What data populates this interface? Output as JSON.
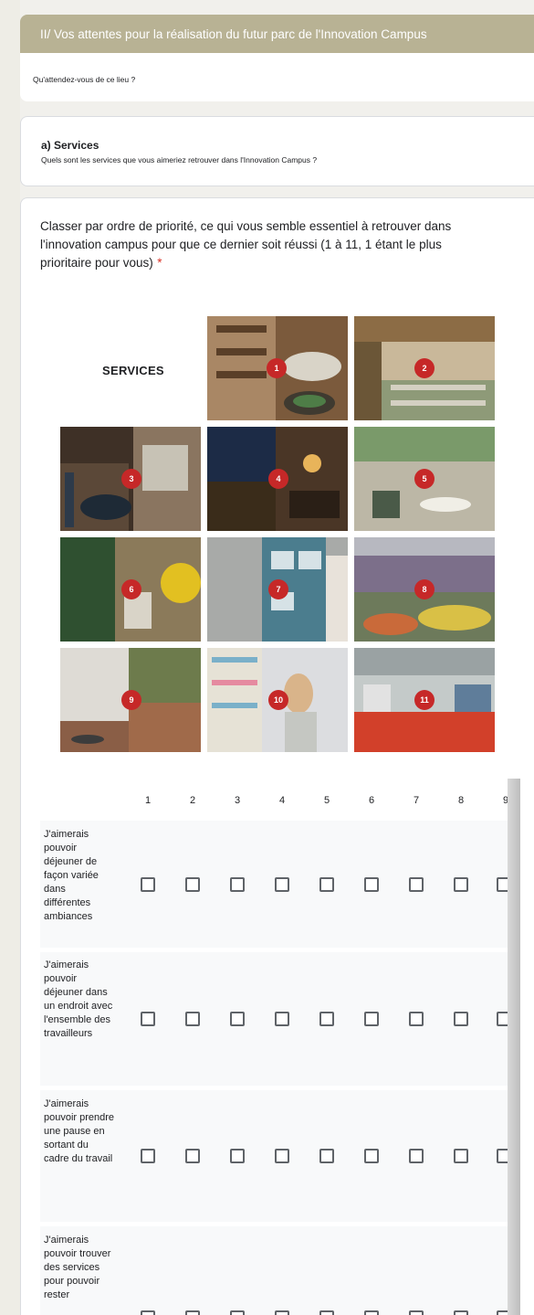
{
  "section": {
    "title": "II/ Vos attentes pour la réalisation du futur parc de l'Innovation Campus",
    "description": "Qu'attendez-vous de ce lieu ?"
  },
  "services": {
    "title": "a) Services",
    "description": "Quels sont les services que vous aimeriez retrouver dans l'Innovation Campus ?"
  },
  "question": {
    "text": "Classer par ordre de priorité, ce qui vous semble essentiel à retrouver dans l'innovation campus pour que ce dernier soit réussi (1 à 11, 1 étant le plus prioritaire pour vous)",
    "required_marker": "*"
  },
  "image": {
    "label": "SERVICES",
    "badges": [
      "1",
      "2",
      "3",
      "4",
      "5",
      "6",
      "7",
      "8",
      "9",
      "10",
      "11"
    ]
  },
  "grid": {
    "columns": [
      "1",
      "2",
      "3",
      "4",
      "5",
      "6",
      "7",
      "8",
      "9"
    ],
    "rows": [
      "J'aimerais pouvoir déjeuner de façon variée dans différentes ambiances",
      "J'aimerais pouvoir déjeuner dans un endroit avec l'ensemble des travailleurs",
      "J'aimerais pouvoir prendre une pause en sortant du cadre du travail",
      "J'aimerais pouvoir trouver des services pour pouvoir rester"
    ]
  },
  "colors": {
    "header_bg": "#b8b294",
    "badge": "#c62828",
    "required": "#d93025"
  }
}
